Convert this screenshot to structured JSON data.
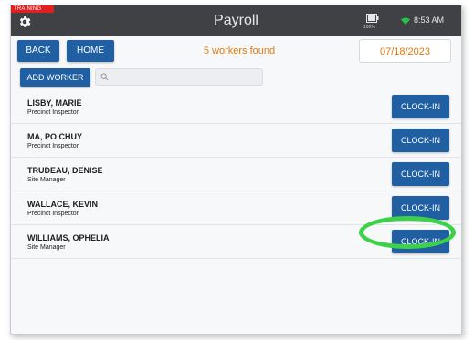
{
  "header": {
    "training_label": "TRAINING",
    "title": "Payroll",
    "battery_text": "100%",
    "time": "8:53 AM",
    "icons": {
      "settings": "gear-icon",
      "battery": "battery-icon",
      "wifi": "wifi-icon"
    }
  },
  "toolbar": {
    "back_label": "BACK",
    "home_label": "HOME",
    "workers_found": "5 workers found",
    "date": "07/18/2023",
    "add_worker_label": "ADD WORKER",
    "search_placeholder": ""
  },
  "workers": [
    {
      "name": "LISBY, MARIE",
      "role": "Precinct Inspector",
      "action": "CLOCK-IN"
    },
    {
      "name": "MA, PO CHUY",
      "role": "Precinct Inspector",
      "action": "CLOCK-IN"
    },
    {
      "name": "TRUDEAU, DENISE",
      "role": "Site Manager",
      "action": "CLOCK-IN"
    },
    {
      "name": "WALLACE, KEVIN",
      "role": "Precinct Inspector",
      "action": "CLOCK-IN"
    },
    {
      "name": "WILLIAMS, OPHELIA",
      "role": "Site Manager",
      "action": "CLOCK-IN"
    }
  ],
  "colors": {
    "header_bg": "#3f4145",
    "button_blue": "#1f5fa2",
    "accent_orange": "#e07a10",
    "training_red": "#e0201f",
    "highlight_green": "#3dd14a",
    "wifi_green": "#27c24c"
  }
}
